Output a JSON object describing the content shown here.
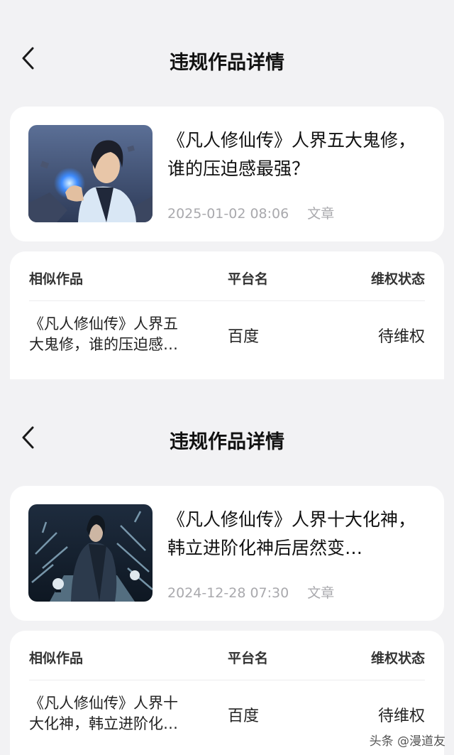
{
  "screens": [
    {
      "nav": {
        "title": "违规作品详情"
      },
      "work": {
        "title": "《凡人修仙传》人界五大鬼修，谁的压迫感最强？",
        "datetime": "2025-01-02 08:06",
        "type": "文章"
      },
      "similar": {
        "headers": {
          "title": "相似作品",
          "platform": "平台名",
          "status": "维权状态"
        },
        "rows": [
          {
            "title": "《凡人修仙传》人界五大鬼修，谁的压迫感最强？",
            "platform": "百度",
            "status": "待维权"
          }
        ]
      }
    },
    {
      "nav": {
        "title": "违规作品详情"
      },
      "work": {
        "title": "《凡人修仙传》人界十大化神，韩立进阶化神后居然变…",
        "datetime": "2024-12-28 07:30",
        "type": "文章"
      },
      "similar": {
        "headers": {
          "title": "相似作品",
          "platform": "平台名",
          "status": "维权状态"
        },
        "rows": [
          {
            "title": "《凡人修仙传》人界十大化神，韩立进阶化神后居然变…",
            "platform": "百度",
            "status": "待维权"
          }
        ]
      }
    }
  ],
  "watermark": "头条 @漫道友"
}
